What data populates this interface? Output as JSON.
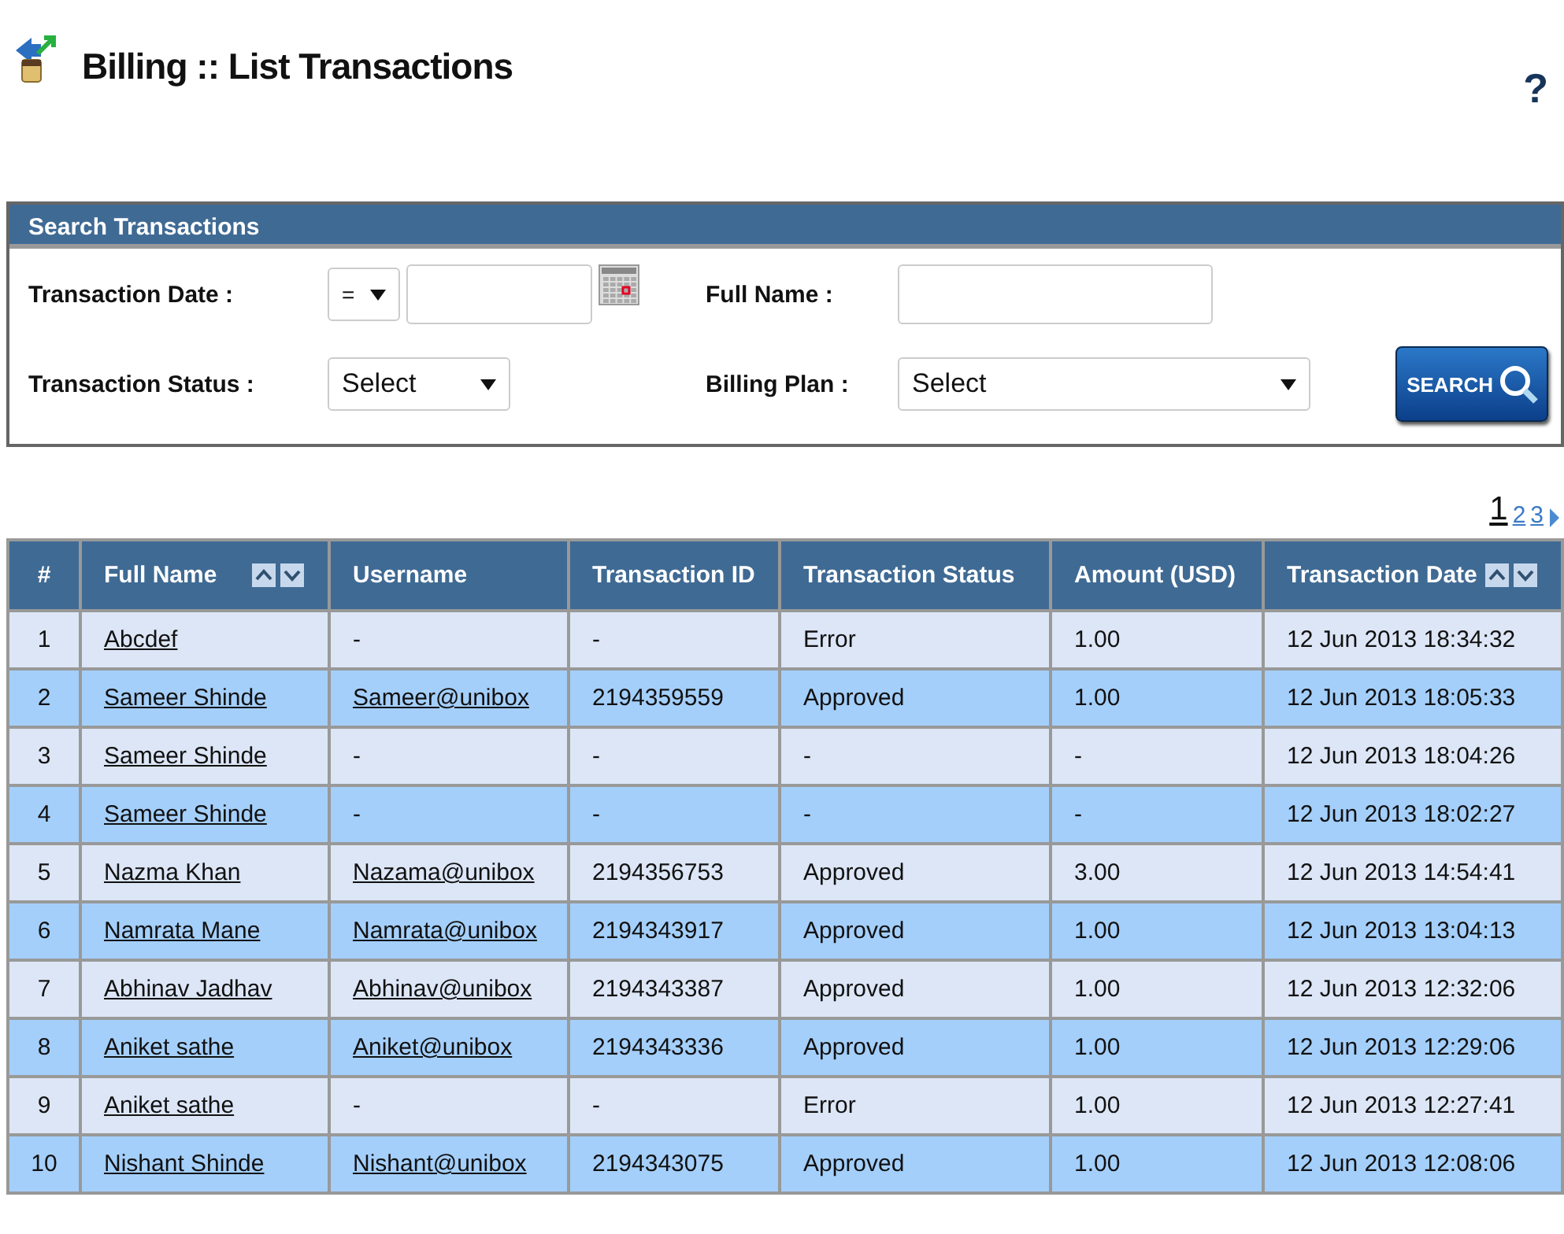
{
  "page": {
    "title": "Billing :: List Transactions",
    "help": "?"
  },
  "search": {
    "title": "Search Transactions",
    "date_label": "Transaction Date :",
    "date_operator": "=",
    "name_label": "Full Name :",
    "status_label": "Transaction Status :",
    "status_value": "Select",
    "plan_label": "Billing Plan :",
    "plan_value": "Select",
    "button": "SEARCH"
  },
  "pagination": [
    {
      "label": "1",
      "selected": true
    },
    {
      "label": "2",
      "selected": false
    },
    {
      "label": "3",
      "selected": false
    }
  ],
  "table": {
    "columns": [
      {
        "label": "#",
        "sortable": false
      },
      {
        "label": "Full Name",
        "sortable": true
      },
      {
        "label": "Username",
        "sortable": false
      },
      {
        "label": "Transaction ID",
        "sortable": false
      },
      {
        "label": "Transaction Status",
        "sortable": false
      },
      {
        "label": "Amount (USD)",
        "sortable": false
      },
      {
        "label": "Transaction Date",
        "sortable": true
      }
    ],
    "rows": [
      {
        "num": "1",
        "name": "Abcdef",
        "username": "-",
        "username_link": false,
        "id": "-",
        "status": "Error",
        "amount": "1.00",
        "date": "12 Jun 2013 18:34:32"
      },
      {
        "num": "2",
        "name": "Sameer Shinde",
        "username": "Sameer@unibox",
        "username_link": true,
        "id": "2194359559",
        "status": "Approved",
        "amount": "1.00",
        "date": "12 Jun 2013 18:05:33"
      },
      {
        "num": "3",
        "name": "Sameer Shinde",
        "username": "-",
        "username_link": false,
        "id": "-",
        "status": "-",
        "amount": "-",
        "date": "12 Jun 2013 18:04:26"
      },
      {
        "num": "4",
        "name": "Sameer Shinde",
        "username": "-",
        "username_link": false,
        "id": "-",
        "status": "-",
        "amount": "-",
        "date": "12 Jun 2013 18:02:27"
      },
      {
        "num": "5",
        "name": "Nazma Khan",
        "username": "Nazama@unibox",
        "username_link": true,
        "id": "2194356753",
        "status": "Approved",
        "amount": "3.00",
        "date": "12 Jun 2013 14:54:41"
      },
      {
        "num": "6",
        "name": "Namrata Mane",
        "username": "Namrata@unibox",
        "username_link": true,
        "id": "2194343917",
        "status": "Approved",
        "amount": "1.00",
        "date": "12 Jun 2013 13:04:13"
      },
      {
        "num": "7",
        "name": "Abhinav Jadhav",
        "username": "Abhinav@unibox",
        "username_link": true,
        "id": "2194343387",
        "status": "Approved",
        "amount": "1.00",
        "date": "12 Jun 2013 12:32:06"
      },
      {
        "num": "8",
        "name": "Aniket sathe",
        "username": "Aniket@unibox",
        "username_link": true,
        "id": "2194343336",
        "status": "Approved",
        "amount": "1.00",
        "date": "12 Jun 2013 12:29:06"
      },
      {
        "num": "9",
        "name": "Aniket sathe",
        "username": "-",
        "username_link": false,
        "id": "-",
        "status": "Error",
        "amount": "1.00",
        "date": "12 Jun 2013 12:27:41"
      },
      {
        "num": "10",
        "name": "Nishant Shinde",
        "username": "Nishant@unibox",
        "username_link": true,
        "id": "2194343075",
        "status": "Approved",
        "amount": "1.00",
        "date": "12 Jun 2013 12:08:06"
      }
    ]
  }
}
